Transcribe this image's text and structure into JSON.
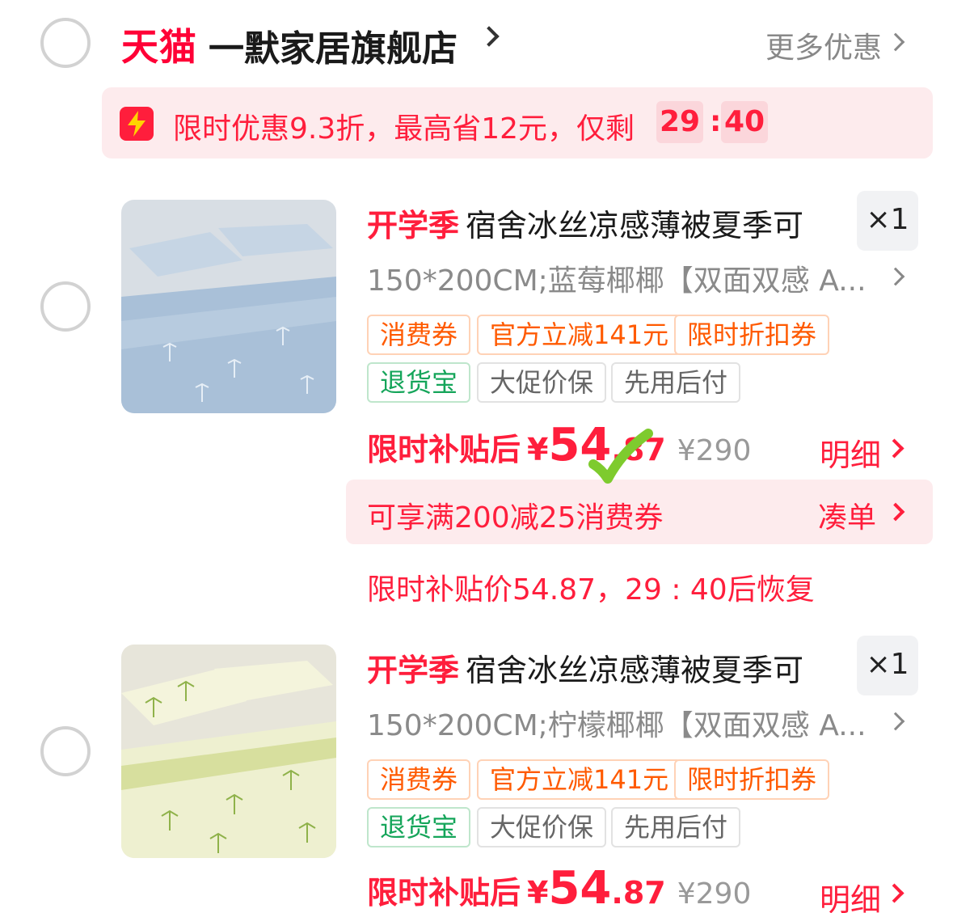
{
  "store": {
    "platform_logo": "天猫",
    "name": "一默家居旗舰店",
    "more_deals": "更多优惠"
  },
  "promo": {
    "icon": "lightning-icon",
    "text": "限时优惠9.3折，最高省12元，仅剩",
    "timer_minutes": "29",
    "timer_separator": ":",
    "timer_seconds": "40"
  },
  "items": [
    {
      "season_tag": "开学季",
      "title": "宿舍冰丝凉感薄被夏季可",
      "quantity": "×1",
      "spec": "150*200CM;蓝莓椰椰【双面双感 A...",
      "image_color": "#a9c0d8",
      "tags_row1": [
        "消费券",
        "官方立减141元",
        "限时折扣券"
      ],
      "tags_row2": [
        "退货宝",
        "大促价保",
        "先用后付"
      ],
      "price_label": "限时补贴后",
      "currency": "¥",
      "price_int": "54",
      "price_dec": ".87",
      "original_price": "¥290",
      "detail_label": "明细",
      "coupon_text": "可享满200减25消费券",
      "coupon_link": "凑单",
      "restore_note": "限时补贴价54.87，29 : 40后恢复"
    },
    {
      "season_tag": "开学季",
      "title": "宿舍冰丝凉感薄被夏季可",
      "quantity": "×1",
      "spec": "150*200CM;柠檬椰椰【双面双感 A...",
      "image_color": "#eef0d0",
      "tags_row1": [
        "消费券",
        "官方立减141元",
        "限时折扣券"
      ],
      "tags_row2": [
        "退货宝",
        "大促价保",
        "先用后付"
      ],
      "price_label": "限时补贴后",
      "currency": "¥",
      "price_int": "54",
      "price_dec": ".87",
      "original_price": "¥290",
      "detail_label": "明细"
    }
  ],
  "colors": {
    "accent_red": "#ff1e3c",
    "tag_orange": "#ff5a00",
    "tag_green": "#15a55a",
    "checkmark_green": "#7ecb2e"
  }
}
